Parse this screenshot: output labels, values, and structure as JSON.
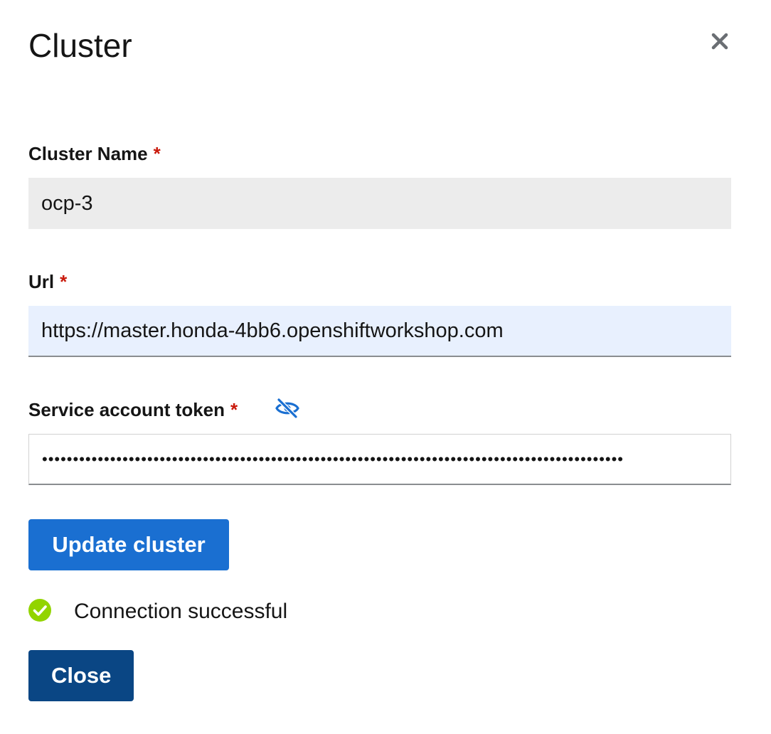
{
  "modal": {
    "title": "Cluster",
    "close_icon": "close-icon"
  },
  "fields": {
    "cluster_name": {
      "label": "Cluster Name",
      "required_marker": "*",
      "value": "ocp-3"
    },
    "url": {
      "label": "Url",
      "required_marker": "*",
      "value": "https://master.honda-4bb6.openshiftworkshop.com"
    },
    "token": {
      "label": "Service account token",
      "required_marker": "*",
      "value": "••••••••••••••••••••••••••••••••••••••••••••••••••••••••••••••••••••••••••••••••••••••••••••••",
      "toggle_icon": "eye-slash-icon"
    }
  },
  "actions": {
    "update_label": "Update cluster",
    "close_label": "Close"
  },
  "status": {
    "icon": "check-circle-icon",
    "text": "Connection successful",
    "color": "#92d400"
  },
  "colors": {
    "primary": "#1a6fd1",
    "secondary_dark": "#0a4684",
    "required": "#c9190b",
    "link": "#1a6fd1"
  }
}
